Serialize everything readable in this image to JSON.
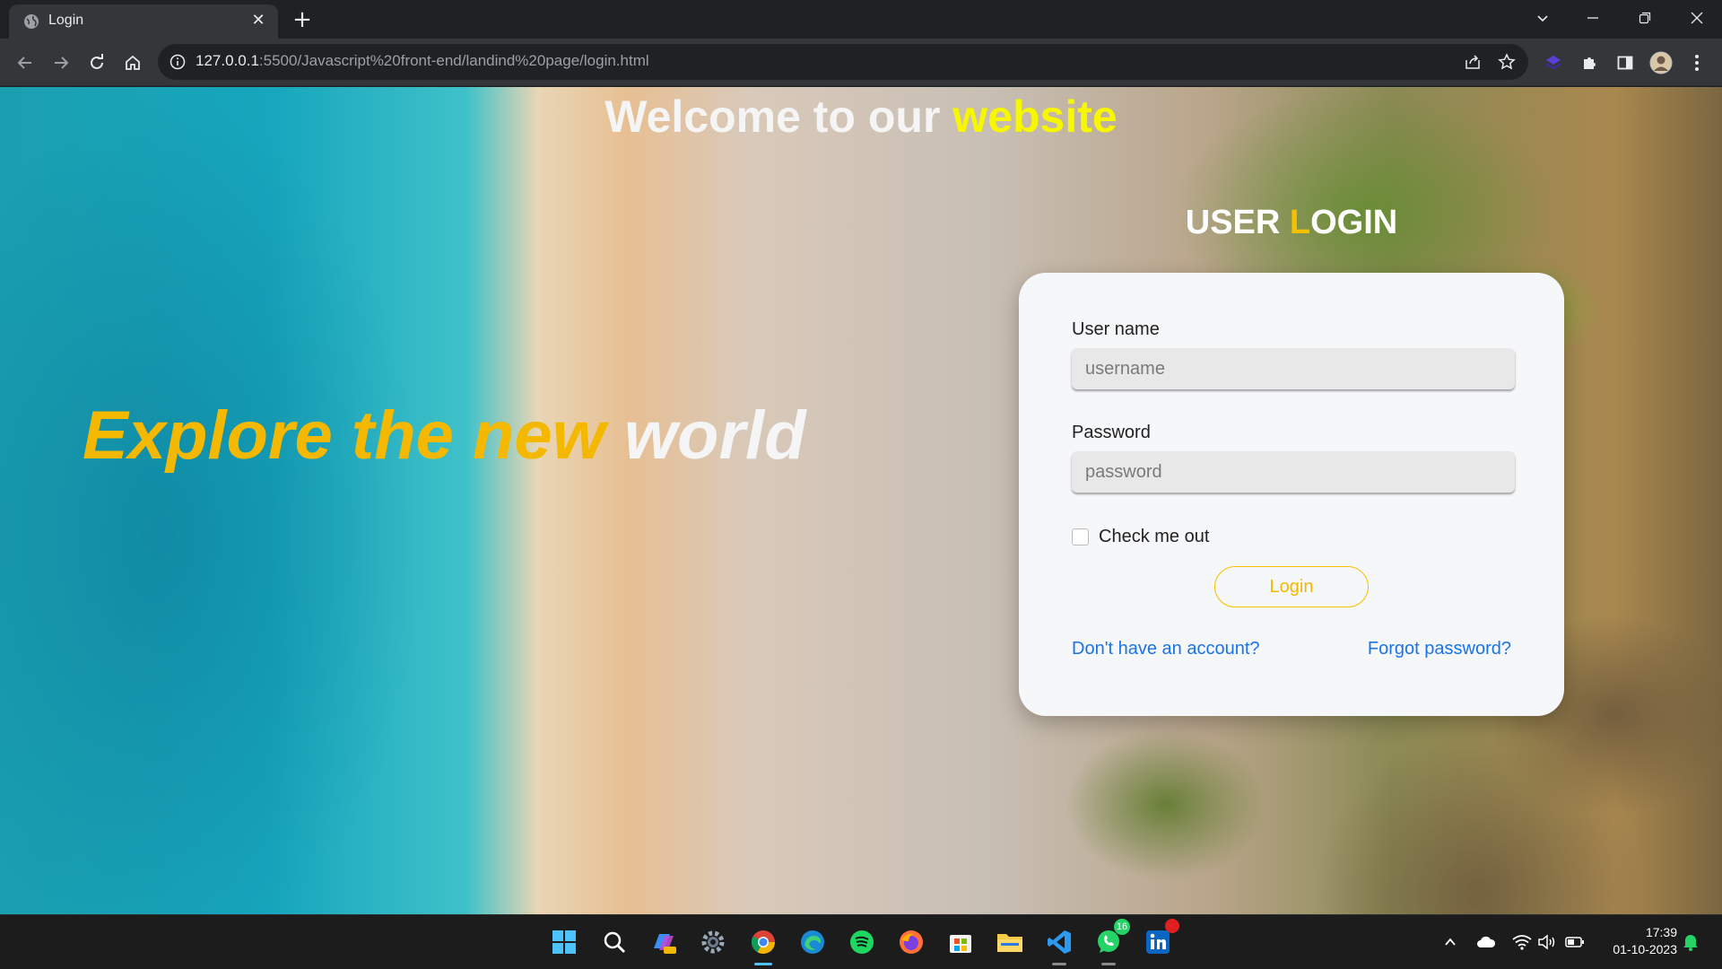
{
  "browser": {
    "tab_title": "Login",
    "url_host": "127.0.0.1",
    "url_rest": ":5500/Javascript%20front-end/landind%20page/login.html"
  },
  "page": {
    "headline_prefix": "Welcome to our ",
    "headline_accent": "website",
    "hero_gold": "Explore the new ",
    "hero_white": "world",
    "login_heading_prefix": "USER ",
    "login_heading_accent": "L",
    "login_heading_suffix": "OGIN",
    "form": {
      "username_label": "User name",
      "username_placeholder": "username",
      "password_label": "Password",
      "password_placeholder": "password",
      "checkbox_label": "Check me out",
      "submit_label": "Login",
      "signup_link": "Don't have an account?",
      "forgot_link": "Forgot password?"
    },
    "colors": {
      "accent_yellow": "#f7f700",
      "accent_gold": "#f5b800",
      "link_blue": "#1a73e8"
    }
  },
  "taskbar": {
    "whatsapp_badge": "16",
    "time": "17:39",
    "date": "01-10-2023"
  }
}
